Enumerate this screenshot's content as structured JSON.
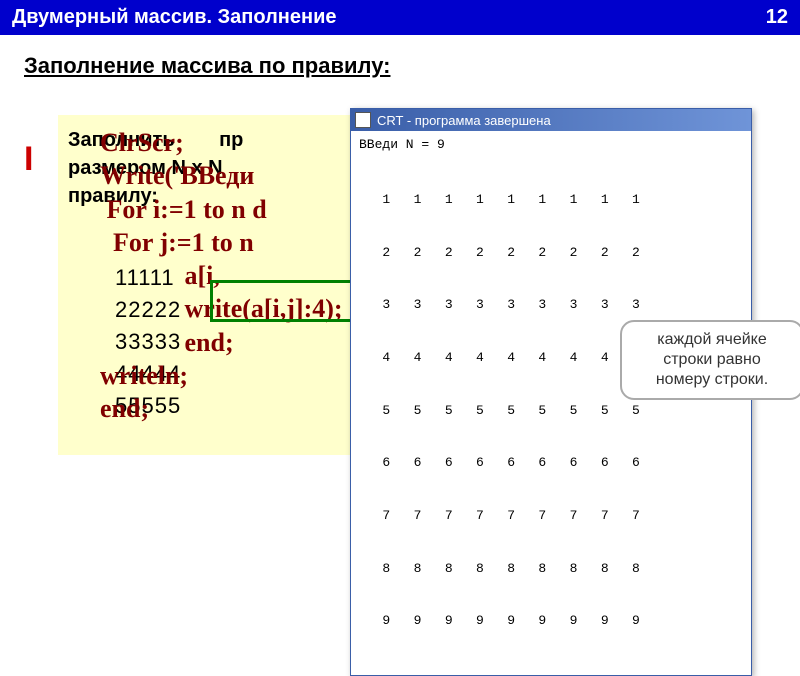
{
  "header": {
    "title": "Двумерный массив. Заполнение",
    "page": "12"
  },
  "section_title": "Заполнение массива по правилу:",
  "task": {
    "word1": "Заполнить",
    "word2": "пр",
    "line2": "размером  N  x  N",
    "line3": "правилу:"
  },
  "pattern": [
    "11111",
    "22222",
    "33333",
    "44444",
    "55555"
  ],
  "code": {
    "l1": "ClrScr;",
    "l1pad": "",
    "l2": "Write('ВВеди",
    "l3": " For i:=1 to n d",
    "l4": "  For j:=1 to n",
    "l5": "             a[i,",
    "l6": "             write(a[i,j]:4);",
    "l7": "             end;",
    "l8": "writeln;",
    "l9": "end;"
  },
  "red_i": "I",
  "crt": {
    "title": "CRT - программа завершена",
    "prompt": "ВВеди N = 9",
    "rows": [
      "   1   1   1   1   1   1   1   1   1",
      "   2   2   2   2   2   2   2   2   2",
      "   3   3   3   3   3   3   3   3   3",
      "   4   4   4   4   4   4   4   4   4",
      "   5   5   5   5   5   5   5   5   5",
      "   6   6   6   6   6   6   6   6   6",
      "   7   7   7   7   7   7   7   7   7",
      "   8   8   8   8   8   8   8   8   8",
      "   9   9   9   9   9   9   9   9   9"
    ]
  },
  "callout": {
    "line1": "каждой ячейке",
    "line2": "строки равно",
    "line3": "номеру строки."
  }
}
